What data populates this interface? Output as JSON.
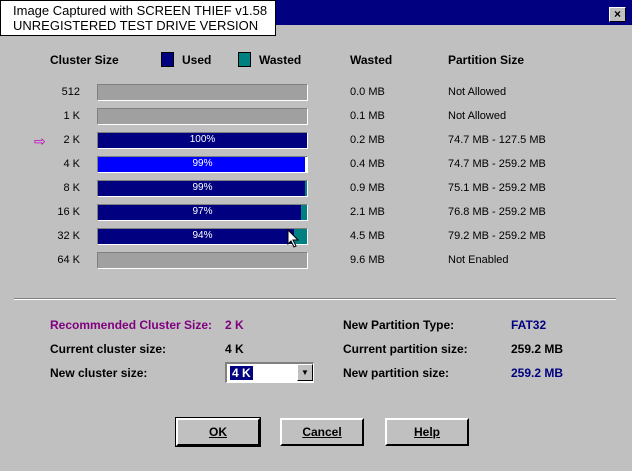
{
  "watermark": {
    "line1": "Image Captured with SCREEN THIEF v1.58",
    "line2": "UNREGISTERED TEST DRIVE VERSION"
  },
  "titlebar": {
    "close_label": "×"
  },
  "headers": {
    "cluster_size": "Cluster Size",
    "used": "Used",
    "wasted_legend": "Wasted",
    "wasted": "Wasted",
    "partition_size": "Partition Size"
  },
  "colors": {
    "used": "#000080",
    "wasted": "#008080",
    "selected_used": "#0000ff"
  },
  "rows": [
    {
      "label": "512",
      "used_pct": null,
      "wasted_frac": 0,
      "pct_text": "",
      "wasted": "0.0 MB",
      "partition": "Not Allowed",
      "selected": false
    },
    {
      "label": "1 K",
      "used_pct": null,
      "wasted_frac": 0,
      "pct_text": "",
      "wasted": "0.1 MB",
      "partition": "Not Allowed",
      "selected": false
    },
    {
      "label": "2 K",
      "used_pct": 100,
      "wasted_frac": 0,
      "pct_text": "100%",
      "wasted": "0.2 MB",
      "partition": "74.7 MB - 127.5 MB",
      "selected": false,
      "arrow": true
    },
    {
      "label": "4 K",
      "used_pct": 99,
      "wasted_frac": 1,
      "pct_text": "99%",
      "wasted": "0.4 MB",
      "partition": "74.7 MB - 259.2 MB",
      "selected": true
    },
    {
      "label": "8 K",
      "used_pct": 99,
      "wasted_frac": 1,
      "pct_text": "99%",
      "wasted": "0.9 MB",
      "partition": "75.1 MB - 259.2 MB",
      "selected": false
    },
    {
      "label": "16 K",
      "used_pct": 97,
      "wasted_frac": 3,
      "pct_text": "97%",
      "wasted": "2.1 MB",
      "partition": "76.8 MB - 259.2 MB",
      "selected": false
    },
    {
      "label": "32 K",
      "used_pct": 94,
      "wasted_frac": 6,
      "pct_text": "94%",
      "wasted": "4.5 MB",
      "partition": "79.2 MB - 259.2 MB",
      "selected": false
    },
    {
      "label": "64 K",
      "used_pct": null,
      "wasted_frac": 0,
      "pct_text": "",
      "wasted": "9.6 MB",
      "partition": "Not Enabled",
      "selected": false
    }
  ],
  "info": {
    "recommended_label": "Recommended Cluster Size:",
    "recommended_value": "2 K",
    "current_label": "Current cluster size:",
    "current_value": "4 K",
    "new_label": "New cluster size:",
    "new_value": "4 K",
    "new_type_label": "New Partition Type:",
    "new_type_value": "FAT32",
    "current_part_label": "Current partition size:",
    "current_part_value": "259.2 MB",
    "new_part_label": "New partition size:",
    "new_part_value": "259.2 MB"
  },
  "buttons": {
    "ok": "OK",
    "cancel": "Cancel",
    "help": "Help"
  }
}
